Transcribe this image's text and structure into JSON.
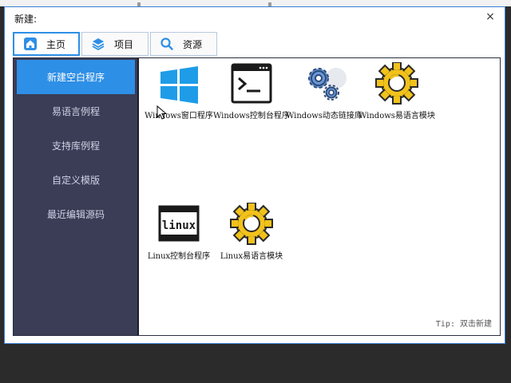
{
  "window": {
    "title": "新建:",
    "close_glyph": "×"
  },
  "tabs": [
    {
      "label": "主页",
      "icon": "home-icon",
      "active": true
    },
    {
      "label": "项目",
      "icon": "layers-icon",
      "active": false
    },
    {
      "label": "资源",
      "icon": "search-icon",
      "active": false
    }
  ],
  "sidebar": {
    "items": [
      {
        "label": "新建空白程序",
        "active": true
      },
      {
        "label": "易语言例程",
        "active": false
      },
      {
        "label": "支持库例程",
        "active": false
      },
      {
        "label": "自定义模版",
        "active": false
      },
      {
        "label": "最近编辑源码",
        "active": false
      }
    ]
  },
  "templates": [
    {
      "label": "Windows窗口程序",
      "icon": "windows-logo-icon"
    },
    {
      "label": "Windows控制台程序",
      "icon": "console-icon"
    },
    {
      "label": "Windows动态链接库",
      "icon": "gears-icon"
    },
    {
      "label": "Windows易语言模块",
      "icon": "gear-icon"
    },
    {
      "label": "Linux控制台程序",
      "icon": "linux-console-icon"
    },
    {
      "label": "Linux易语言模块",
      "icon": "gear-icon"
    }
  ],
  "tip": "Tip: 双击新建",
  "colors": {
    "accent": "#2e8fe6",
    "sidebar_bg": "#3a3d55",
    "gear_yellow": "#f2c21b",
    "windows_blue": "#1e9ce8"
  }
}
